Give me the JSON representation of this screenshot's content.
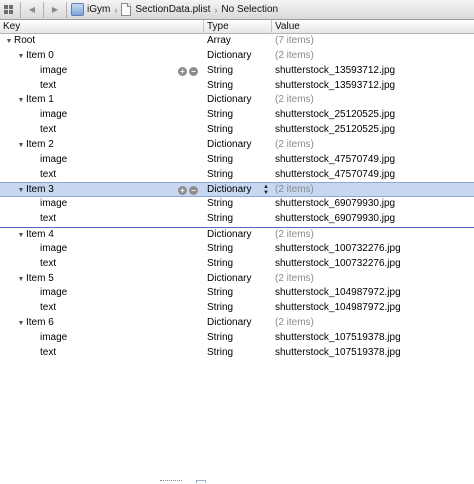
{
  "jumpbar": {
    "project": "iGym",
    "file": "SectionData.plist",
    "selection": "No Selection",
    "back_icon": "back-arrow-icon",
    "forward_icon": "forward-arrow-icon"
  },
  "columns": {
    "key": "Key",
    "type": "Type",
    "value": "Value"
  },
  "colors": {
    "selected_row": "#c7d7f0",
    "gray_text": "#8a8a8a"
  },
  "rows": [
    {
      "key": "Root",
      "type": "Array",
      "value": "(7 items)",
      "level": 0,
      "disclosure": "open",
      "gray": true
    },
    {
      "key": "Item 0",
      "type": "Dictionary",
      "value": "(2 items)",
      "level": 1,
      "disclosure": "open",
      "gray": true
    },
    {
      "key": "image",
      "type": "String",
      "value": "shutterstock_13593712.jpg",
      "level": 2,
      "plus_minus": true
    },
    {
      "key": "text",
      "type": "String",
      "value": "shutterstock_13593712.jpg",
      "level": 2
    },
    {
      "key": "Item 1",
      "type": "Dictionary",
      "value": "(2 items)",
      "level": 1,
      "disclosure": "open",
      "gray": true
    },
    {
      "key": "image",
      "type": "String",
      "value": "shutterstock_25120525.jpg",
      "level": 2
    },
    {
      "key": "text",
      "type": "String",
      "value": "shutterstock_25120525.jpg",
      "level": 2
    },
    {
      "key": "Item 2",
      "type": "Dictionary",
      "value": "(2 items)",
      "level": 1,
      "disclosure": "open",
      "gray": true
    },
    {
      "key": "image",
      "type": "String",
      "value": "shutterstock_47570749.jpg",
      "level": 2
    },
    {
      "key": "text",
      "type": "String",
      "value": "shutterstock_47570749.jpg",
      "level": 2
    },
    {
      "key": "Item 3",
      "type": "Dictionary",
      "value": "(2 items)",
      "level": 1,
      "disclosure": "open",
      "gray": true,
      "selected": true,
      "plus_minus": true,
      "stepper": true
    },
    {
      "key": "image",
      "type": "String",
      "value": "shutterstock_69079930.jpg",
      "level": 2
    },
    {
      "key": "text",
      "type": "String",
      "value": "shutterstock_69079930.jpg",
      "level": 2
    },
    {
      "key": "Item 4",
      "type": "Dictionary",
      "value": "(2 items)",
      "level": 1,
      "disclosure": "open",
      "gray": true,
      "after_selected": true
    },
    {
      "key": "image",
      "type": "String",
      "value": "shutterstock_100732276.jpg",
      "level": 2
    },
    {
      "key": "text",
      "type": "String",
      "value": "shutterstock_100732276.jpg",
      "level": 2
    },
    {
      "key": "Item 5",
      "type": "Dictionary",
      "value": "(2 items)",
      "level": 1,
      "disclosure": "open",
      "gray": true
    },
    {
      "key": "image",
      "type": "String",
      "value": "shutterstock_104987972.jpg",
      "level": 2
    },
    {
      "key": "text",
      "type": "String",
      "value": "shutterstock_104987972.jpg",
      "level": 2
    },
    {
      "key": "Item 6",
      "type": "Dictionary",
      "value": "(2 items)",
      "level": 1,
      "disclosure": "open",
      "gray": true
    },
    {
      "key": "image",
      "type": "String",
      "value": "shutterstock_107519378.jpg",
      "level": 2
    },
    {
      "key": "text",
      "type": "String",
      "value": "shutterstock_107519378.jpg",
      "level": 2
    }
  ]
}
